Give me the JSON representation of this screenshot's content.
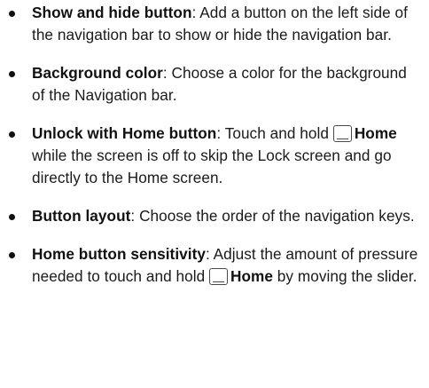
{
  "items": [
    {
      "term": "Show and hide button",
      "sep": ": ",
      "text": "Add a button on the left side of the navigation bar to show or hide the navigation bar."
    },
    {
      "term": "Background color",
      "sep": ": ",
      "text": "Choose a color for the background of the Navigation bar."
    },
    {
      "term": "Unlock with Home button",
      "sep": ": ",
      "text_before": "Touch and hold ",
      "home_label": "Home",
      "text_after": " while the screen is off to skip the Lock screen and go directly to the Home screen."
    },
    {
      "term": "Button layout",
      "sep": ": ",
      "text": "Choose the order of the navigation keys."
    },
    {
      "term": "Home button sensitivity",
      "sep": ": ",
      "text_before": "Adjust the amount of pressure needed to touch and hold ",
      "home_label": "Home",
      "text_after": " by moving the slider."
    }
  ],
  "icons": {
    "home_key": "home-key-icon",
    "bullet": "bullet-dot"
  }
}
